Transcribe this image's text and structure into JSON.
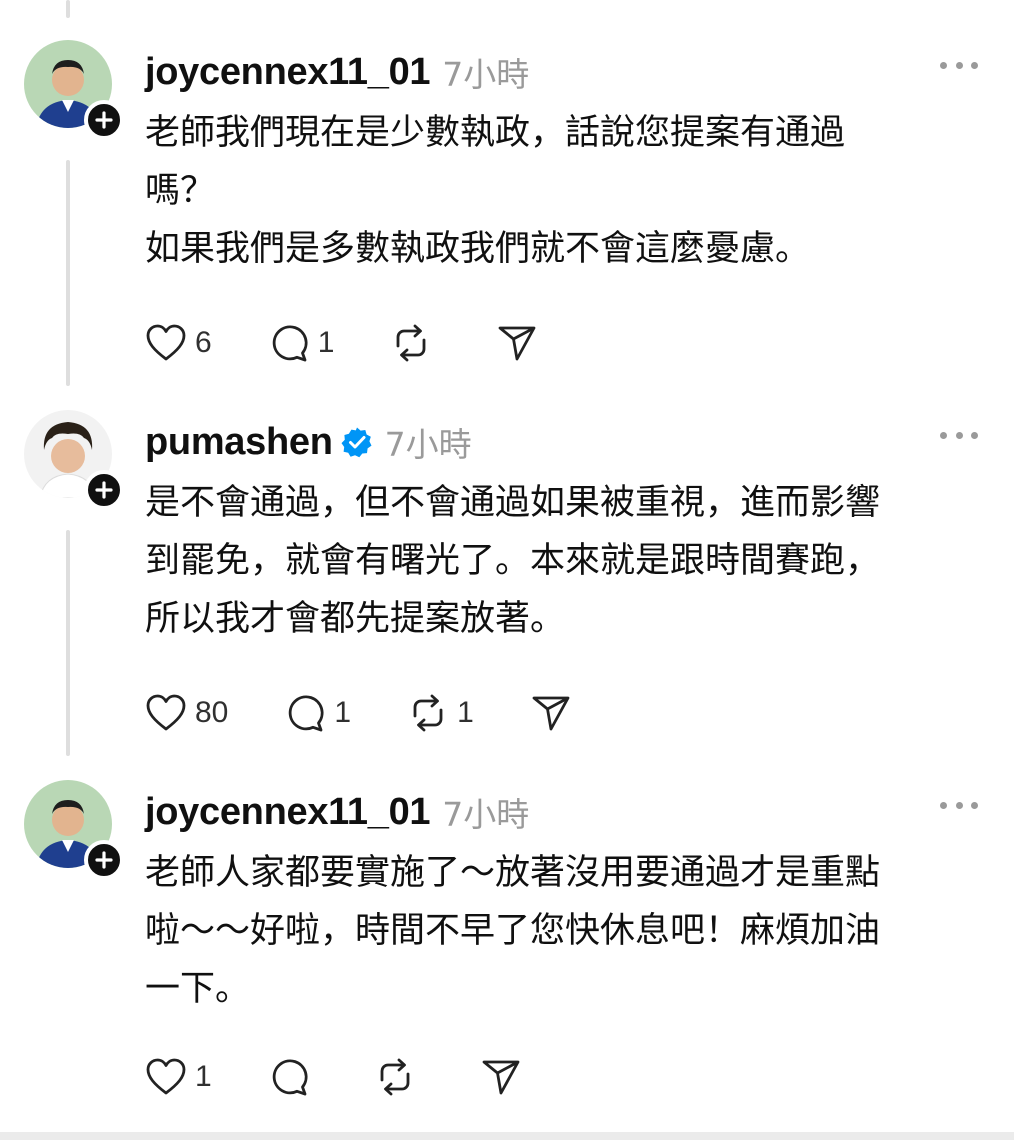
{
  "posts": [
    {
      "username": "joycennex11_01",
      "time": "7小時",
      "verified": false,
      "lines": [
        "老師我們現在是少數執政，話說您提案有通過",
        "嗎？",
        "如果我們是多數執政我們就不會這麼憂慮。"
      ],
      "likes": "6",
      "replies": "1",
      "reposts": ""
    },
    {
      "username": "pumashen",
      "time": "7小時",
      "verified": true,
      "lines": [
        "是不會通過，但不會通過如果被重視，進而影響",
        "到罷免，就會有曙光了。本來就是跟時間賽跑，",
        "所以我才會都先提案放著。"
      ],
      "likes": "80",
      "replies": "1",
      "reposts": "1"
    },
    {
      "username": "joycennex11_01",
      "time": "7小時",
      "verified": false,
      "lines": [
        "老師人家都要實施了～放著沒用要通過才是重點",
        "啦～～好啦，時間不早了您快休息吧！麻煩加油",
        "一下。"
      ],
      "likes": "1",
      "replies": "",
      "reposts": ""
    }
  ],
  "colors": {
    "text": "#101010",
    "muted": "#9a9a9a",
    "verified": "#0095f6",
    "thread_line": "#dedede"
  },
  "icons": {
    "like": "heart-icon",
    "reply": "comment-bubble-icon",
    "repost": "repost-icon",
    "share": "send-icon",
    "more": "more-horizontal-icon",
    "follow": "plus-icon",
    "verified": "verified-badge-icon"
  }
}
